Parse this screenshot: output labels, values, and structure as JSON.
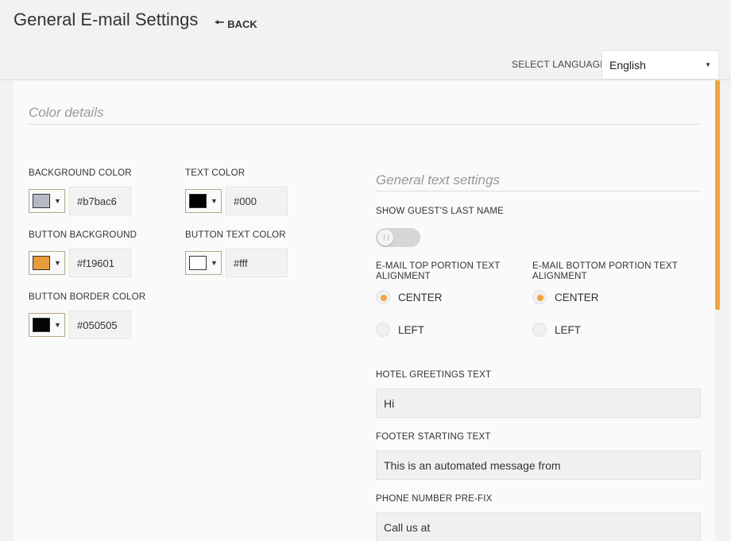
{
  "header": {
    "title": "General E-mail Settings",
    "back_label": "BACK"
  },
  "language": {
    "label": "SELECT LANGUAGE",
    "selected": "English"
  },
  "color_details": {
    "title": "Color details",
    "fields": [
      {
        "label": "BACKGROUND COLOR",
        "value": "#b7bac6",
        "swatch": "#b7bac6"
      },
      {
        "label": "TEXT COLOR",
        "value": "#000",
        "swatch": "#000000"
      },
      {
        "label": "BUTTON BACKGROUND",
        "value": "#f19601",
        "swatch": "#e99a3a"
      },
      {
        "label": "BUTTON TEXT COLOR",
        "value": "#fff",
        "swatch": "#ffffff"
      },
      {
        "label": "BUTTON BORDER COLOR",
        "value": "#050505",
        "swatch": "#050505"
      }
    ]
  },
  "general_text": {
    "title": "General text settings",
    "show_last_name_label": "SHOW GUEST'S LAST NAME",
    "top_alignment": {
      "label": "E-MAIL TOP PORTION TEXT ALIGNMENT",
      "options": [
        "CENTER",
        "LEFT"
      ],
      "selected": "CENTER"
    },
    "bottom_alignment": {
      "label": "E-MAIL BOTTOM PORTION TEXT ALIGNMENT",
      "options": [
        "CENTER",
        "LEFT"
      ],
      "selected": "CENTER"
    },
    "greetings": {
      "label": "HOTEL GREETINGS TEXT",
      "value": "Hi"
    },
    "footer": {
      "label": "FOOTER STARTING TEXT",
      "value": "This is an automated message from"
    },
    "phone_prefix": {
      "label": "PHONE NUMBER PRE-FIX",
      "value": "Call us at"
    }
  },
  "colors": {
    "accent": "#f0a540"
  }
}
